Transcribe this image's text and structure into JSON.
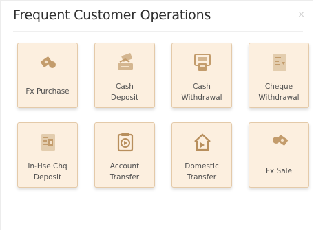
{
  "panel": {
    "title": "Frequent Customer Operations",
    "close_glyph": "×"
  },
  "operations": [
    {
      "label": "Fx Purchase",
      "icon": "fx-purchase-icon"
    },
    {
      "label": "Cash\nDeposit",
      "icon": "cash-deposit-icon"
    },
    {
      "label": "Cash\nWithdrawal",
      "icon": "cash-withdrawal-icon"
    },
    {
      "label": "Cheque\nWithdrawal",
      "icon": "cheque-withdrawal-icon"
    },
    {
      "label": "In-Hse Chq\nDeposit",
      "icon": "in-house-cheque-deposit-icon"
    },
    {
      "label": "Account\nTransfer",
      "icon": "account-transfer-icon"
    },
    {
      "label": "Domestic\nTransfer",
      "icon": "domestic-transfer-icon"
    },
    {
      "label": "Fx Sale",
      "icon": "fx-sale-icon"
    }
  ],
  "colors": {
    "tile_background": "#fcefdf",
    "tile_border": "#e4caa9",
    "icon_color": "#c8a477"
  }
}
